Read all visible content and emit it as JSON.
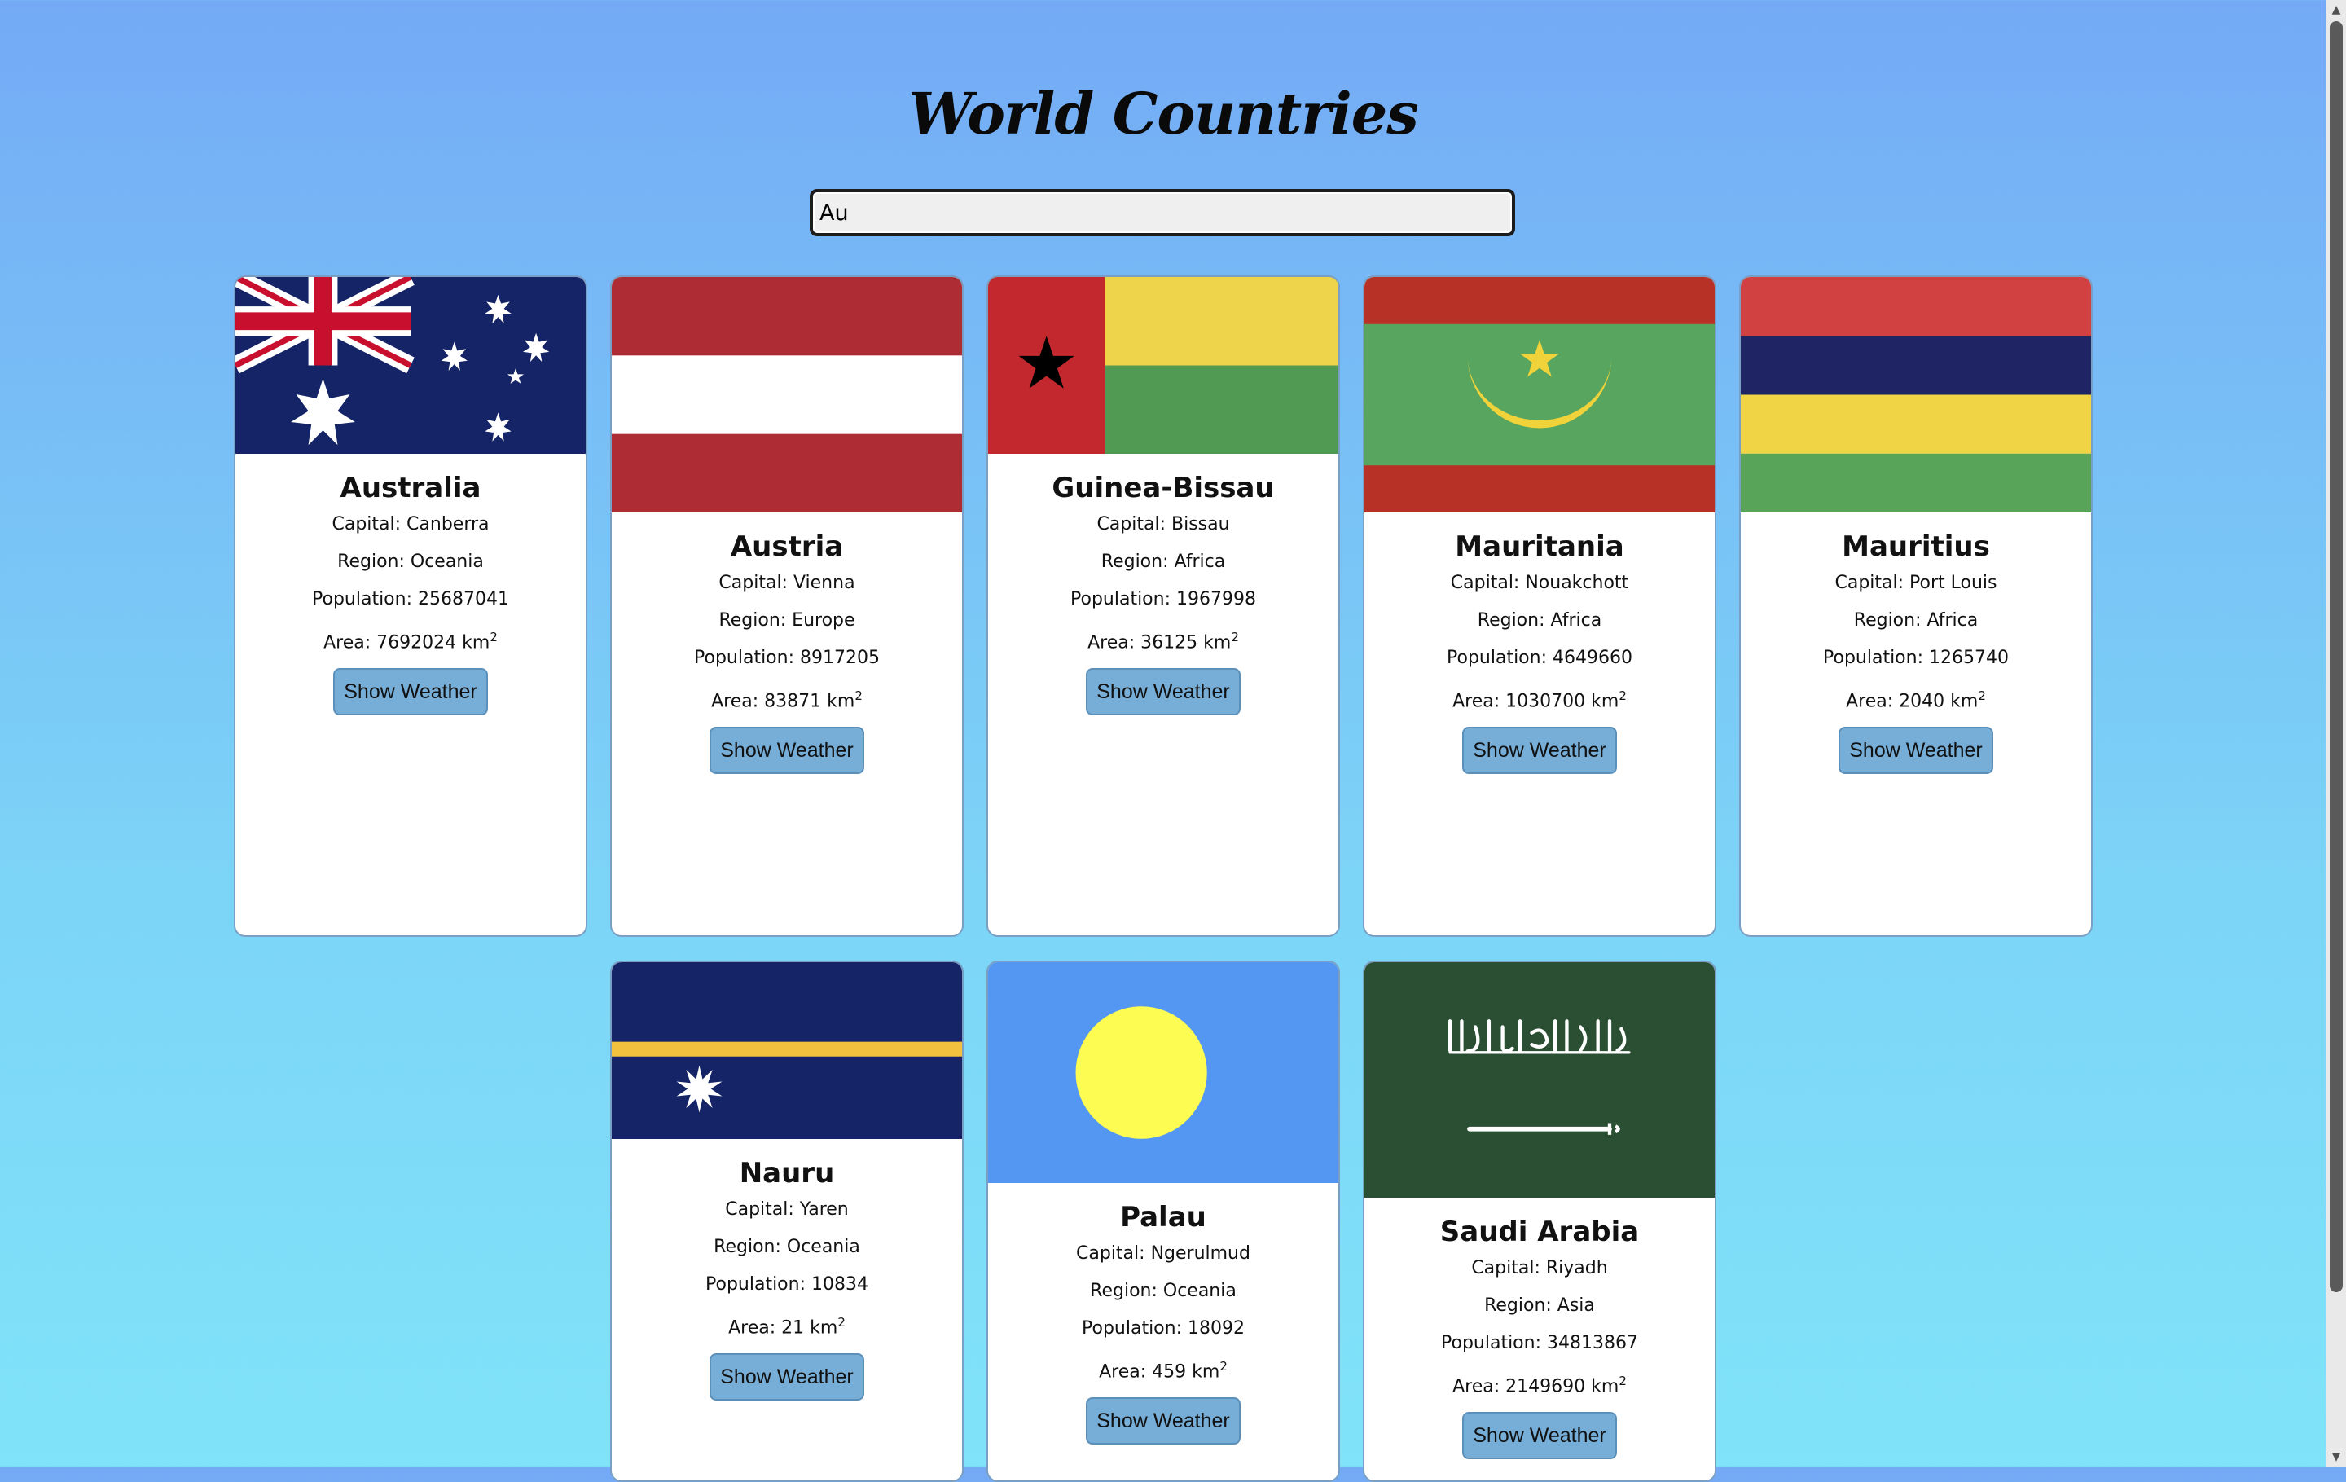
{
  "page": {
    "title": "World Countries"
  },
  "search": {
    "value": "Au",
    "placeholder": ""
  },
  "labels": {
    "capital": "Capital: ",
    "region": "Region: ",
    "population": "Population: ",
    "area": "Area: ",
    "area_unit": " km",
    "area_exp": "2",
    "button": "Show Weather"
  },
  "countries": [
    {
      "name": "Australia",
      "capital": "Canberra",
      "region": "Oceania",
      "population": "25687041",
      "area": "7692024",
      "flag": "australia-flag"
    },
    {
      "name": "Austria",
      "capital": "Vienna",
      "region": "Europe",
      "population": "8917205",
      "area": "83871",
      "flag": "austria-flag"
    },
    {
      "name": "Guinea-Bissau",
      "capital": "Bissau",
      "region": "Africa",
      "population": "1967998",
      "area": "36125",
      "flag": "guinea-bissau-flag"
    },
    {
      "name": "Mauritania",
      "capital": "Nouakchott",
      "region": "Africa",
      "population": "4649660",
      "area": "1030700",
      "flag": "mauritania-flag"
    },
    {
      "name": "Mauritius",
      "capital": "Port Louis",
      "region": "Africa",
      "population": "1265740",
      "area": "2040",
      "flag": "mauritius-flag"
    },
    {
      "name": "Nauru",
      "capital": "Yaren",
      "region": "Oceania",
      "population": "10834",
      "area": "21",
      "flag": "nauru-flag"
    },
    {
      "name": "Palau",
      "capital": "Ngerulmud",
      "region": "Oceania",
      "population": "18092",
      "area": "459",
      "flag": "palau-flag"
    },
    {
      "name": "Saudi Arabia",
      "capital": "Riyadh",
      "region": "Asia",
      "population": "34813867",
      "area": "2149690",
      "flag": "saudi-arabia-flag"
    }
  ],
  "colors": {
    "background_top": "#74aaf5",
    "background_bottom": "#80e3f9",
    "button": "#76aed8",
    "card_border": "#7a9fc4"
  }
}
